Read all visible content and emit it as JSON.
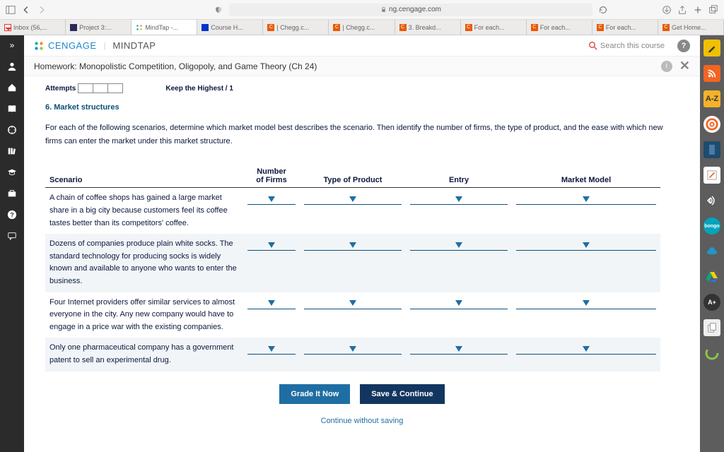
{
  "browser": {
    "url": "ng.cengage.com"
  },
  "tabs": [
    {
      "label": "Inbox (56,..."
    },
    {
      "label": "Project 3:..."
    },
    {
      "label": "MindTap -..."
    },
    {
      "label": "Course H..."
    },
    {
      "label": "| Chegg.c..."
    },
    {
      "label": "| Chegg.c..."
    },
    {
      "label": "3. Breakd..."
    },
    {
      "label": "For each..."
    },
    {
      "label": "For each..."
    },
    {
      "label": "For each..."
    },
    {
      "label": "Get Home..."
    }
  ],
  "brand": {
    "company": "CENGAGE",
    "product": "MINDTAP"
  },
  "search_label": "Search this course",
  "hw_title": "Homework: Monopolistic Competition, Oligopoly, and Game Theory (Ch 24)",
  "attempts": {
    "label": "Attempts",
    "keep": "Keep the Highest / 1"
  },
  "question": {
    "number": "6.",
    "title": "Market structures",
    "instructions": "For each of the following scenarios, determine which market model best describes the scenario. Then identify the number of firms, the type of product, and the ease with which new firms can enter the market under this market structure."
  },
  "table": {
    "headers": {
      "scenario": "Scenario",
      "firms": "Number\nof Firms",
      "product": "Type of Product",
      "entry": "Entry",
      "model": "Market Model"
    },
    "rows": [
      {
        "scenario": "A chain of coffee shops has gained a large market share in a big city because customers feel its coffee tastes better than its competitors' coffee."
      },
      {
        "scenario": "Dozens of companies produce plain white socks. The standard technology for producing socks is widely known and available to anyone who wants to enter the business."
      },
      {
        "scenario": "Four Internet providers offer similar services to almost everyone in the city. Any new company would have to engage in a price war with the existing companies."
      },
      {
        "scenario": "Only one pharmaceutical company has a government patent to sell an experimental drug."
      }
    ]
  },
  "buttons": {
    "grade": "Grade It Now",
    "save": "Save & Continue",
    "continue": "Continue without saving"
  }
}
